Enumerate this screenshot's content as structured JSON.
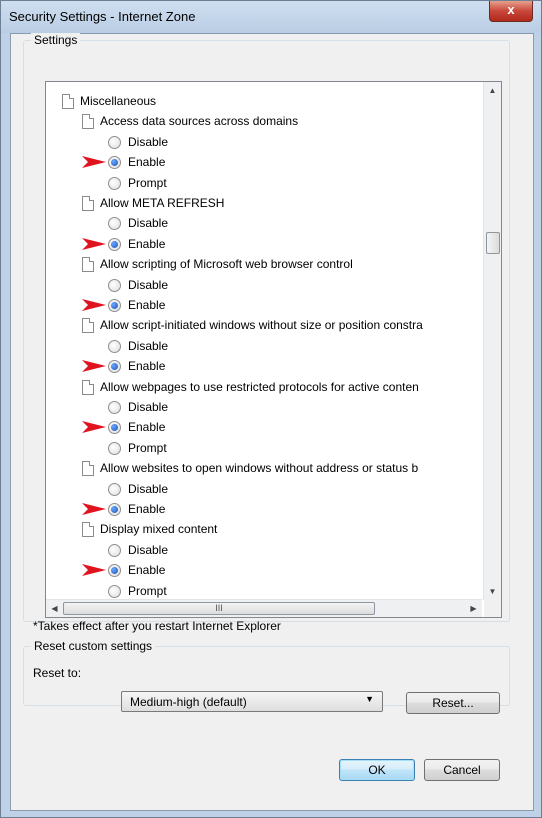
{
  "window": {
    "title": "Security Settings - Internet Zone",
    "close_glyph": "x"
  },
  "settings": {
    "group_label": "Settings",
    "tree": [
      {
        "type": "header",
        "text": "Miscellaneous"
      },
      {
        "type": "option",
        "text": "Access data sources across domains"
      },
      {
        "type": "radio",
        "text": "Disable",
        "checked": false,
        "arrow": false
      },
      {
        "type": "radio",
        "text": "Enable",
        "checked": true,
        "arrow": true
      },
      {
        "type": "radio",
        "text": "Prompt",
        "checked": false,
        "arrow": false
      },
      {
        "type": "option",
        "text": "Allow META REFRESH"
      },
      {
        "type": "radio",
        "text": "Disable",
        "checked": false,
        "arrow": false
      },
      {
        "type": "radio",
        "text": "Enable",
        "checked": true,
        "arrow": true
      },
      {
        "type": "option",
        "text": "Allow scripting of Microsoft web browser control"
      },
      {
        "type": "radio",
        "text": "Disable",
        "checked": false,
        "arrow": false
      },
      {
        "type": "radio",
        "text": "Enable",
        "checked": true,
        "arrow": true
      },
      {
        "type": "option",
        "text": "Allow script-initiated windows without size or position constra"
      },
      {
        "type": "radio",
        "text": "Disable",
        "checked": false,
        "arrow": false
      },
      {
        "type": "radio",
        "text": "Enable",
        "checked": true,
        "arrow": true
      },
      {
        "type": "option",
        "text": "Allow webpages to use restricted protocols for active conten"
      },
      {
        "type": "radio",
        "text": "Disable",
        "checked": false,
        "arrow": false
      },
      {
        "type": "radio",
        "text": "Enable",
        "checked": true,
        "arrow": true
      },
      {
        "type": "radio",
        "text": "Prompt",
        "checked": false,
        "arrow": false
      },
      {
        "type": "option",
        "text": "Allow websites to open windows without address or status b"
      },
      {
        "type": "radio",
        "text": "Disable",
        "checked": false,
        "arrow": false
      },
      {
        "type": "radio",
        "text": "Enable",
        "checked": true,
        "arrow": true
      },
      {
        "type": "option",
        "text": "Display mixed content"
      },
      {
        "type": "radio",
        "text": "Disable",
        "checked": false,
        "arrow": false
      },
      {
        "type": "radio",
        "text": "Enable",
        "checked": true,
        "arrow": true
      },
      {
        "type": "radio",
        "text": "Prompt",
        "checked": false,
        "arrow": false
      }
    ],
    "note": "*Takes effect after you restart Internet Explorer",
    "arrow_color": "#e0141e",
    "hscroll_grip": "III"
  },
  "reset": {
    "group_label": "Reset custom settings",
    "reset_to_label": "Reset to:",
    "selected_level": "Medium-high (default)",
    "reset_button": "Reset..."
  },
  "buttons": {
    "ok": "OK",
    "cancel": "Cancel"
  }
}
